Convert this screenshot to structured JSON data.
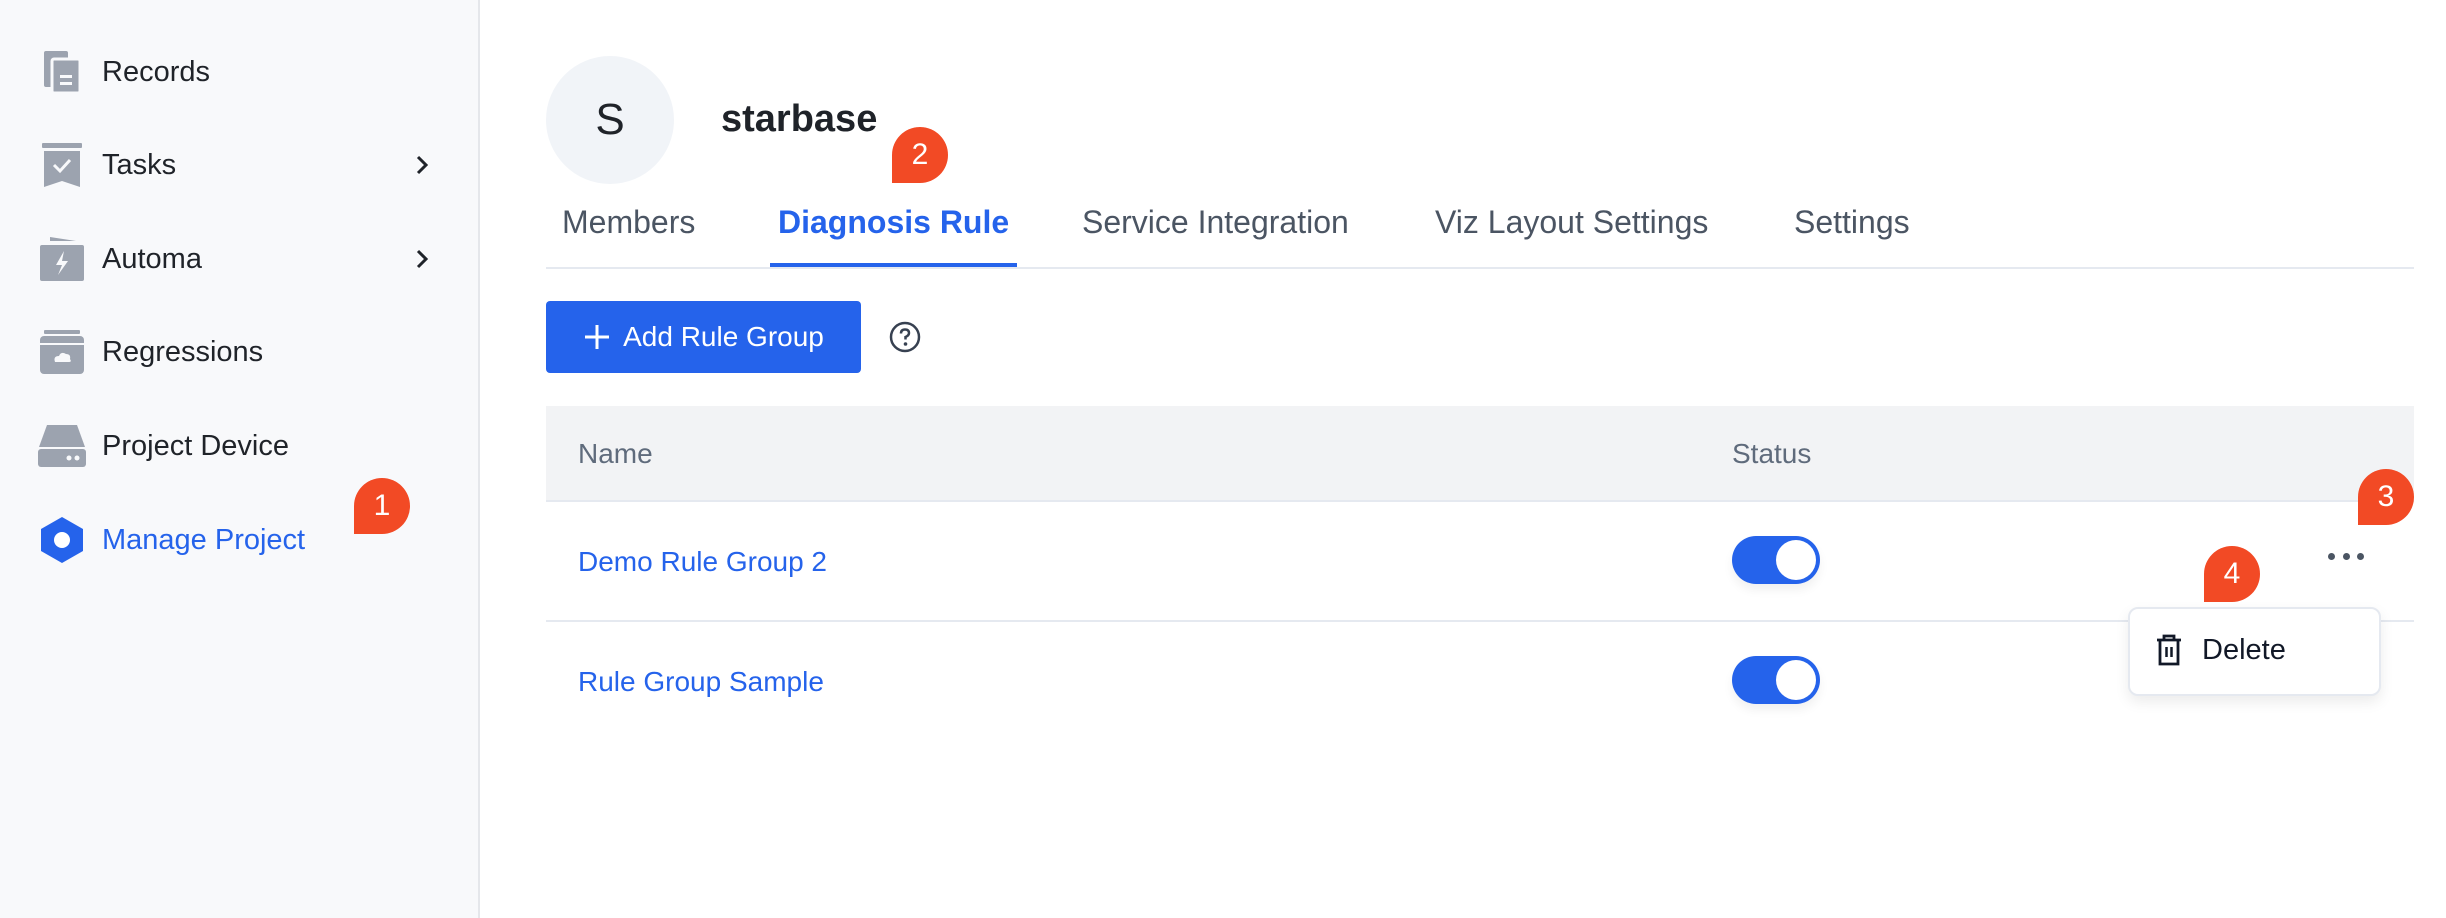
{
  "sidebar": {
    "items": [
      {
        "label": "Records",
        "icon": "records-icon",
        "has_chevron": false,
        "active": false
      },
      {
        "label": "Tasks",
        "icon": "tasks-icon",
        "has_chevron": true,
        "active": false
      },
      {
        "label": "Automa",
        "icon": "automa-icon",
        "has_chevron": true,
        "active": false
      },
      {
        "label": "Regressions",
        "icon": "regressions-icon",
        "has_chevron": false,
        "active": false
      },
      {
        "label": "Project Device",
        "icon": "device-icon",
        "has_chevron": false,
        "active": false
      },
      {
        "label": "Manage Project",
        "icon": "manage-project-icon",
        "has_chevron": false,
        "active": true
      }
    ]
  },
  "project": {
    "avatar_letter": "S",
    "name": "starbase"
  },
  "tabs": [
    {
      "label": "Members",
      "active": false
    },
    {
      "label": "Diagnosis Rule",
      "active": true
    },
    {
      "label": "Service Integration",
      "active": false
    },
    {
      "label": "Viz Layout Settings",
      "active": false
    },
    {
      "label": "Settings",
      "active": false
    }
  ],
  "toolbar": {
    "add_label": "Add Rule Group",
    "help_icon": "question-circle-icon"
  },
  "table": {
    "columns": [
      "Name",
      "Status"
    ],
    "rows": [
      {
        "name": "Demo Rule Group 2",
        "status_enabled": true
      },
      {
        "name": "Rule Group Sample",
        "status_enabled": true
      }
    ]
  },
  "row_menu": {
    "items": [
      {
        "label": "Delete",
        "icon": "trash-icon"
      }
    ]
  },
  "markers": [
    "1",
    "2",
    "3",
    "4"
  ],
  "colors": {
    "accent": "#2563eb",
    "marker": "#f24a25",
    "sidebar_bg": "#f8f9fb",
    "icon_gray": "#9ca3af"
  }
}
